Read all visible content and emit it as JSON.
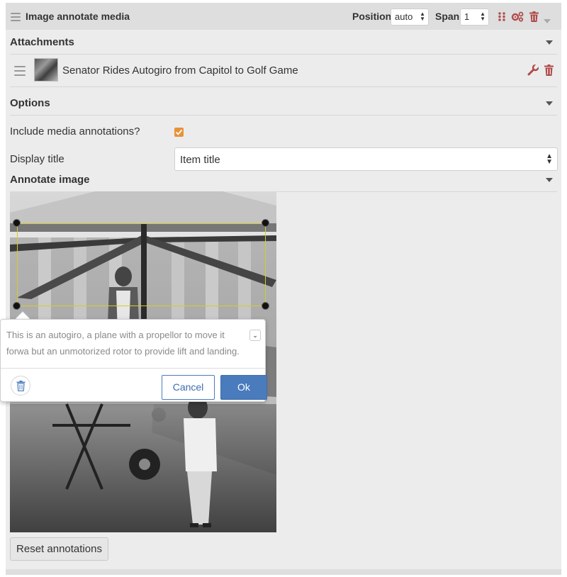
{
  "block": {
    "title": "Image annotate media",
    "position_label": "Position",
    "position_value": "auto",
    "span_label": "Span",
    "span_value": "1"
  },
  "attachments": {
    "title": "Attachments",
    "items": [
      {
        "title": "Senator Rides Autogiro from Capitol to Golf Game"
      }
    ]
  },
  "options": {
    "title": "Options",
    "include_annotations_label": "Include media annotations?",
    "include_annotations_checked": true,
    "display_title_label": "Display title",
    "display_title_value": "Item title"
  },
  "annotate": {
    "title": "Annotate image",
    "popup_text": "This is an autogiro, a plane with a propellor to move it forwa but an unmotorized rotor to provide lift and landing.",
    "cancel_label": "Cancel",
    "ok_label": "Ok",
    "reset_label": "Reset annotations"
  },
  "colors": {
    "accent_blue": "#4a7bbd",
    "danger_red": "#b14a4a",
    "checkbox_orange": "#e8923a",
    "annotation_yellow": "#d7cb2a"
  },
  "icons": [
    "drag-handle-icon",
    "grid-icon",
    "gears-icon",
    "trash-icon",
    "wrench-icon",
    "chevron-down-icon"
  ]
}
